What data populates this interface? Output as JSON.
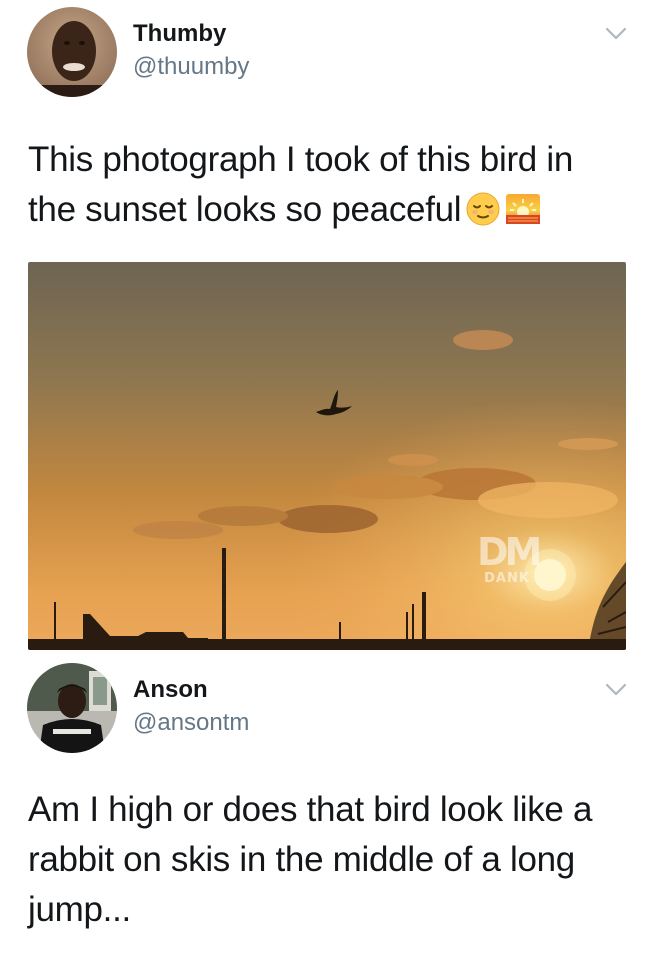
{
  "tweets": [
    {
      "display_name": "Thumby",
      "handle": "@thuumby",
      "text_lines": [
        "This photograph I took of this bird in",
        "the sunset looks so peaceful"
      ],
      "emojis": [
        "relieved-face-emoji",
        "sunrise-emoji"
      ],
      "media": {
        "description_icon": "sunset-photo",
        "watermark": {
          "mark": "DM",
          "text": "DANK"
        }
      },
      "menu_icon": "chevron-down-icon"
    },
    {
      "display_name": "Anson",
      "handle": "@ansontm",
      "text_lines": [
        "Am I high or does that bird look like a",
        "rabbit on skis in the middle of a long",
        "jump..."
      ],
      "menu_icon": "chevron-down-icon"
    }
  ],
  "colors": {
    "text_primary": "#14171a",
    "text_secondary": "#657786",
    "chevron": "#aab8c2",
    "sky_top": "#6e6554",
    "sky_bottom": "#f2a85a"
  }
}
